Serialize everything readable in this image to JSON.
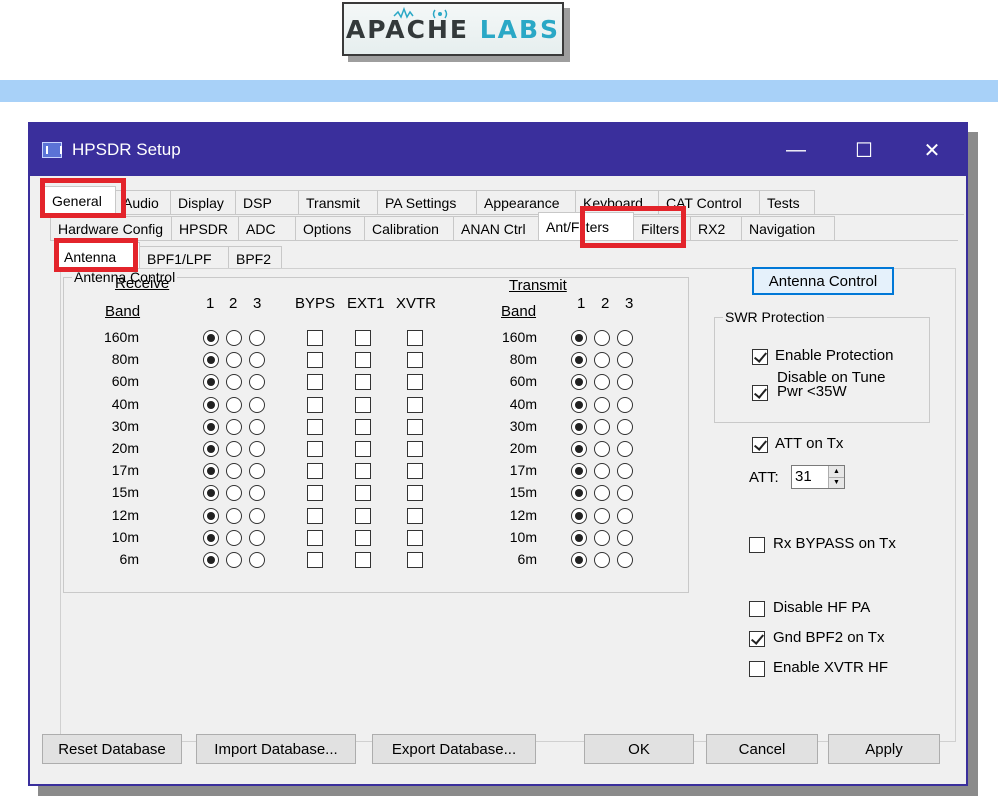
{
  "logo": {
    "apache": "APACHE",
    "labs": "LABS"
  },
  "window": {
    "title": "HPSDR Setup",
    "minimize": "—",
    "maximize": "☐",
    "close": "✕"
  },
  "tabs_row1": [
    "General",
    "Audio",
    "Display",
    "DSP",
    "Transmit",
    "PA Settings",
    "Appearance",
    "Keyboard",
    "CAT Control",
    "Tests"
  ],
  "tabs_row2": [
    "Hardware Config",
    "HPSDR",
    "ADC",
    "Options",
    "Calibration",
    "ANAN Ctrl",
    "Ant/Filters",
    "Filters",
    "RX2",
    "Navigation"
  ],
  "tabs_row3": [
    "Antenna",
    "BPF1/LPF",
    "BPF2"
  ],
  "antenna_control": {
    "group_title": "Antenna Control",
    "receive_label": "Receive",
    "transmit_label": "Transmit",
    "band_label": "Band",
    "col_1": "1",
    "col_2": "2",
    "col_3": "3",
    "byps": "BYPS",
    "ext1": "EXT1",
    "xvtr": "XVTR",
    "bands": [
      "160m",
      "80m",
      "60m",
      "40m",
      "30m",
      "20m",
      "17m",
      "15m",
      "12m",
      "10m",
      "6m"
    ],
    "rx_selected": [
      1,
      1,
      1,
      1,
      1,
      1,
      1,
      1,
      1,
      1,
      1
    ],
    "tx_selected": [
      1,
      1,
      1,
      1,
      1,
      1,
      1,
      1,
      1,
      1,
      1
    ]
  },
  "right": {
    "antenna_control_button": "Antenna Control",
    "swr_group": "SWR Protection",
    "enable_protection": "Enable Protection",
    "disable_on_tune_1": "Disable on Tune",
    "disable_on_tune_2": "Pwr <35W",
    "att_on_tx": "ATT on Tx",
    "att_label": "ATT:",
    "att_value": "31",
    "rx_bypass": "Rx BYPASS on Tx",
    "disable_hf_pa": "Disable HF PA",
    "gnd_bpf2": "Gnd BPF2 on Tx",
    "enable_xvtr_hf": "Enable XVTR HF"
  },
  "bottom": {
    "reset": "Reset Database",
    "import": "Import Database...",
    "export": "Export Database...",
    "ok": "OK",
    "cancel": "Cancel",
    "apply": "Apply"
  },
  "colors": {
    "titlebar": "#3a2f9c",
    "highlight": "#e3242b",
    "band": "#a8d1f8",
    "accent": "#2aa8c6"
  }
}
